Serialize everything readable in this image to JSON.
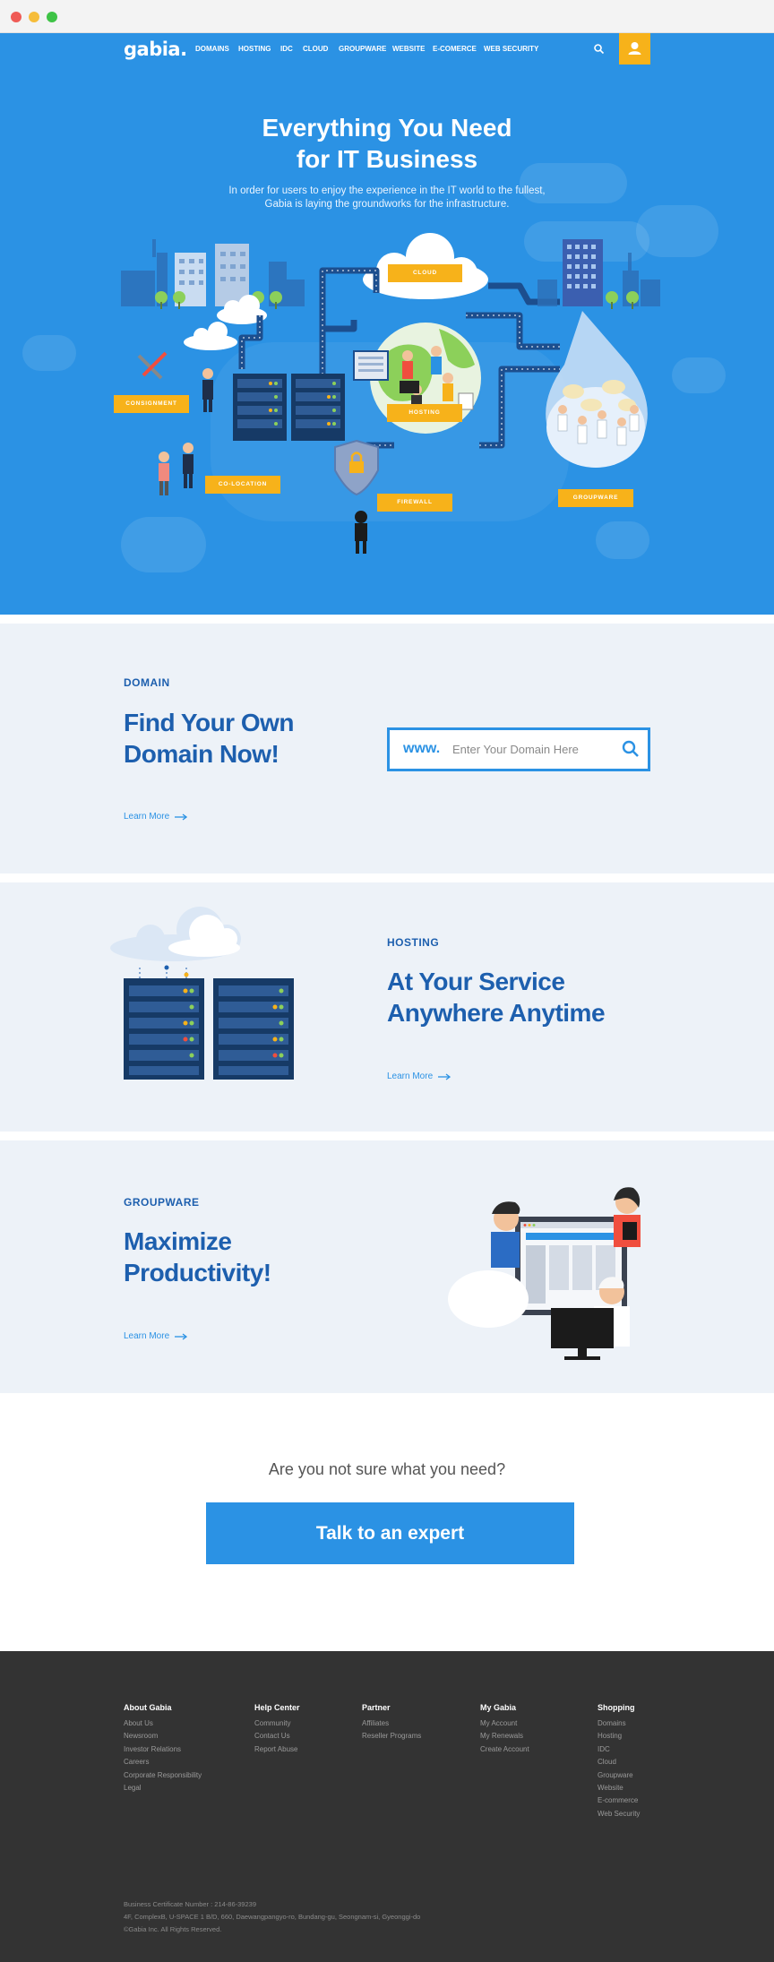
{
  "browser": {
    "buttons": [
      "close",
      "minimize",
      "maximize"
    ]
  },
  "nav": {
    "logo": "gabia.",
    "items": [
      "DOMAINS",
      "HOSTING",
      "IDC",
      "CLOUD",
      "GROUPWARE",
      "WEBSITE",
      "E-COMERCE",
      "WEB SECURITY"
    ],
    "search_icon": "search-icon",
    "user_icon": "user-icon"
  },
  "hero": {
    "title_line1": "Everything You Need",
    "title_line2": "for IT Business",
    "subtitle_line1": "In order for users to enjoy the experience in the IT world to the fullest,",
    "subtitle_line2": "Gabia is laying the groundworks for the infrastructure.",
    "tags": {
      "cloud": "CLOUD",
      "consignment": "CONSIGNMENT",
      "hosting": "HOSTING",
      "colocation": "CO-LOCATION",
      "firewall": "FIREWALL",
      "groupware": "GROUPWARE"
    }
  },
  "domain": {
    "label": "DOMAIN",
    "title_line1": "Find Your Own",
    "title_line2": "Domain Now!",
    "www": "www.",
    "placeholder": "Enter Your Domain Here",
    "learn_more": "Learn More"
  },
  "hosting": {
    "label": "HOSTING",
    "title_line1": "At Your Service",
    "title_line2": "Anywhere Anytime",
    "learn_more": "Learn More"
  },
  "groupware": {
    "label": "GROUPWARE",
    "title_line1": "Maximize",
    "title_line2": "Productivity!",
    "learn_more": "Learn More"
  },
  "cta": {
    "question": "Are you not sure what you need?",
    "button": "Talk to an expert"
  },
  "footer": {
    "columns": [
      {
        "title": "About Gabia",
        "links": [
          "About Us",
          "Newsroom",
          "Investor Relations",
          "Careers",
          "Corporate Responsibility",
          "Legal"
        ]
      },
      {
        "title": "Help Center",
        "links": [
          "Community",
          "Contact Us",
          "Report Abuse"
        ]
      },
      {
        "title": "Partner",
        "links": [
          "Affiliates",
          "Reseller Programs"
        ]
      },
      {
        "title": "My Gabia",
        "links": [
          "My Account",
          "My Renewals",
          "Create Account"
        ]
      },
      {
        "title": "Shopping",
        "links": [
          "Domains",
          "Hosting",
          "IDC",
          "Cloud",
          "Groupware",
          "Website",
          "E-commerce",
          "Web Security"
        ]
      }
    ],
    "info_line1": "Business Certificate Number : 214-86-39239",
    "info_line2": "4F, ComplexB, U-SPACE 1 B/D, 660, Daewangpangyo-ro, Bundang-gu, Seongnam-si, Gyeonggi-do",
    "info_line3": "©Gabia Inc. All Rights Reserved."
  },
  "colors": {
    "primary_blue": "#2b92e4",
    "dark_blue": "#1d5fae",
    "accent_yellow": "#f7b21a",
    "section_bg": "#edf2f8",
    "footer_bg": "#333333"
  }
}
